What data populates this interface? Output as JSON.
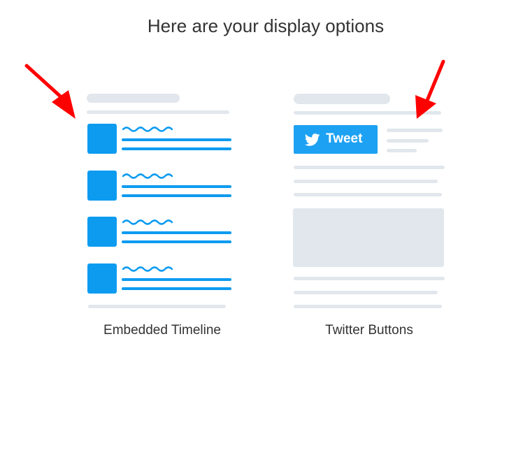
{
  "page": {
    "heading": "Here are your display options"
  },
  "options": [
    {
      "label": "Embedded Timeline"
    },
    {
      "label": "Twitter Buttons",
      "tweet_button_label": "Tweet"
    }
  ],
  "colors": {
    "accent": "#1da1f2",
    "timeline_blue": "#0d9bf0",
    "placeholder_gray": "#e1e7ec",
    "annotation_red": "#ff0000"
  }
}
